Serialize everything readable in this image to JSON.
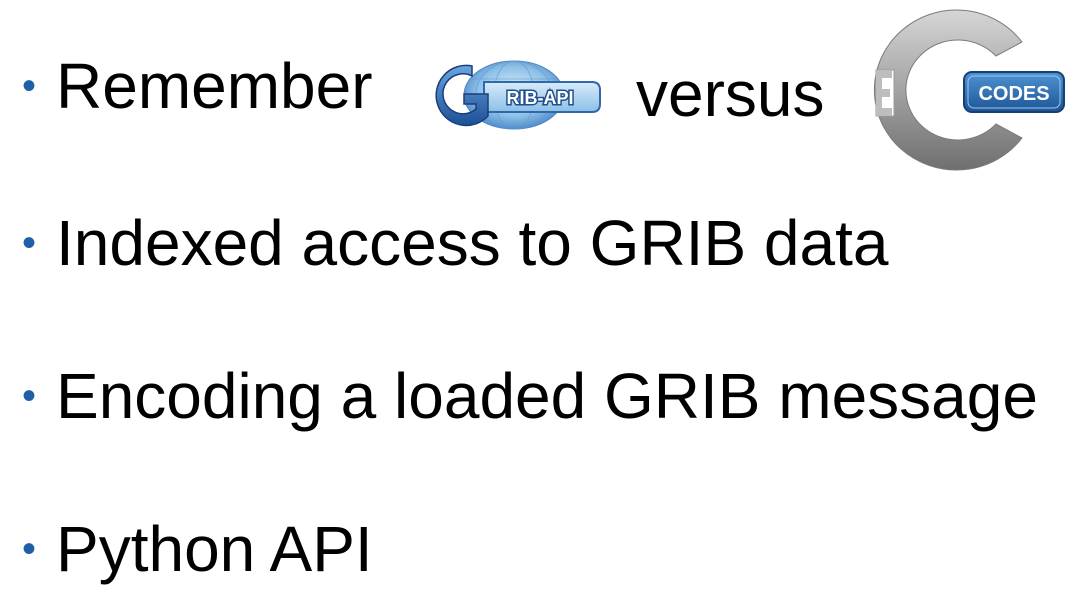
{
  "bullets": [
    {
      "text": "Remember",
      "versus": "versus"
    },
    {
      "text": "Indexed access to GRIB data"
    },
    {
      "text": "Encoding a loaded GRIB message"
    },
    {
      "text": "Python API"
    }
  ],
  "logos": {
    "grib": {
      "lettering": "GRIB-API"
    },
    "ecodes": {
      "lettering": "ecCODES",
      "e_letter": "E",
      "badge": "CODES"
    }
  },
  "colors": {
    "bullet": "#1f5fa8",
    "text": "#000000",
    "grib_blue": "#2a6cc2",
    "ecodes_grey": "#9a9a9a",
    "ecodes_badge": "#2b6fb0"
  }
}
